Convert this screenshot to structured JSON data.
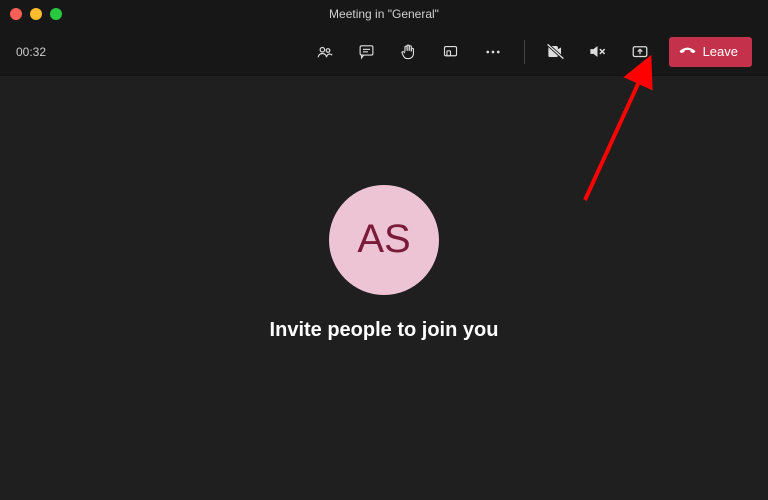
{
  "titlebar": {
    "title": "Meeting in \"General\""
  },
  "toolbar": {
    "timer": "00:32",
    "leave_label": "Leave"
  },
  "participant": {
    "initials": "AS"
  },
  "main": {
    "invite_text": "Invite people to join you"
  }
}
